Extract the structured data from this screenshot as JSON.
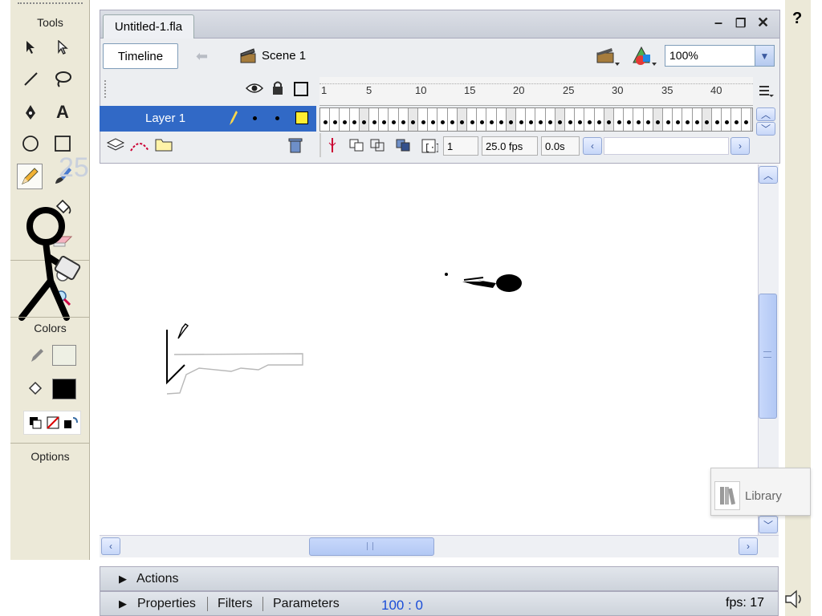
{
  "tools_panel": {
    "title": "Tools",
    "overlay_text": "25",
    "colors_label": "Colors",
    "options_label": "Options"
  },
  "document": {
    "tab_title": "Untitled-1.fla",
    "timeline_button": "Timeline",
    "scene_label": "Scene 1",
    "zoom_value": "100%"
  },
  "timeline": {
    "frame_numbers": [
      "1",
      "5",
      "10",
      "15",
      "20",
      "25",
      "30",
      "35",
      "40"
    ],
    "layer_name": "Layer 1",
    "current_frame": "1",
    "frame_rate": "25.0 fps",
    "elapsed_time": "0.0s"
  },
  "library": {
    "label": "Library"
  },
  "bottom_panels": {
    "actions_label": "Actions",
    "properties_label": "Properties",
    "filters_label": "Filters",
    "parameters_label": "Parameters",
    "center_readout": "100 : 0",
    "fps_readout": "fps: 17"
  },
  "help_label": "?",
  "colors": {
    "layer_highlight": "#3169c6",
    "layer_color_box": "#ffee33",
    "scroll_thumb": "#b2c8f4",
    "readout_blue": "#1a4dd8"
  }
}
